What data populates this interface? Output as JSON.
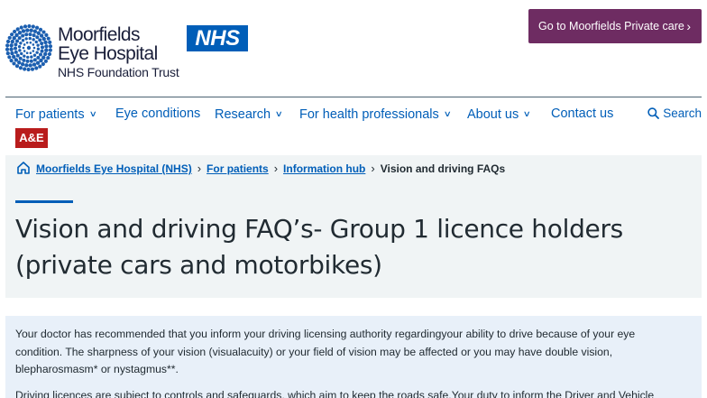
{
  "header": {
    "logo": {
      "line1": "Moorfields",
      "line2": "Eye Hospital",
      "line3": "NHS Foundation Trust"
    },
    "nhs_badge": "NHS",
    "private_care_button": "Go to Moorfields Private care",
    "brand_colors": {
      "nhs_blue": "#005eb8",
      "private_purple": "#6e2c62",
      "ae_red": "#b91c1c"
    }
  },
  "nav": {
    "items": [
      {
        "label": "For patients",
        "has_dropdown": true
      },
      {
        "label": "Eye conditions",
        "has_dropdown": false
      },
      {
        "label": "Research",
        "has_dropdown": true
      },
      {
        "label": "For health professionals",
        "has_dropdown": true
      },
      {
        "label": "About us",
        "has_dropdown": true
      },
      {
        "label": "Contact us",
        "has_dropdown": false
      }
    ],
    "search_label": "Search",
    "ae_label": "A&E"
  },
  "breadcrumb": {
    "links": [
      "Moorfields Eye Hospital (NHS)",
      "For patients",
      "Information hub"
    ],
    "current": "Vision and driving FAQs"
  },
  "page": {
    "title": "Vision and driving FAQ’s- Group 1 licence holders (private cars and motorbikes)"
  },
  "content": {
    "paragraph1": "Your doctor has recommended that you inform your driving licensing authority regardingyour ability to drive because of your eye condition. The sharpness of your vision (visualacuity) or your field of vision may be affected or you may have double vision, blepharosmasm* or nystagmus**.",
    "paragraph2": "Driving licences are subject to controls and safeguards, which aim to keep the roads safe.Your duty to inform the Driver and Vehicle"
  }
}
